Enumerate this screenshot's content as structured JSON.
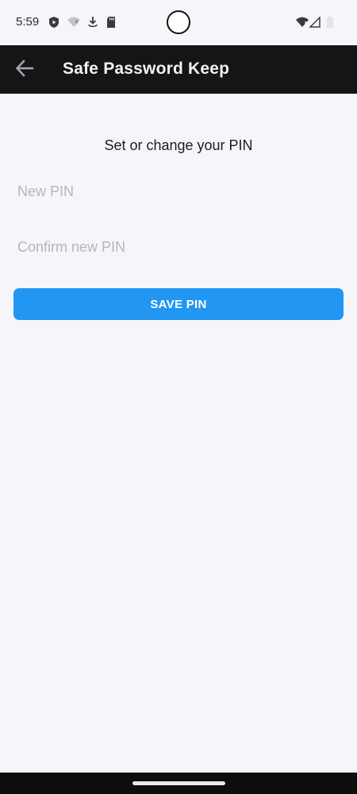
{
  "status_bar": {
    "time": "5:59",
    "left_icons": [
      "shield-icon",
      "wifi-question-icon",
      "download-icon",
      "sd-card-icon"
    ],
    "right_icons": [
      "wifi-icon",
      "signal-icon",
      "battery-icon"
    ]
  },
  "toolbar": {
    "back_icon": "arrow-left-icon",
    "title": "Safe Password Keep",
    "background": "#151517"
  },
  "main": {
    "heading": "Set or change your PIN",
    "new_pin": {
      "placeholder": "New PIN",
      "value": ""
    },
    "confirm_pin": {
      "placeholder": "Confirm new PIN",
      "value": ""
    },
    "save_label": "SAVE PIN",
    "accent": "#2196f3"
  }
}
